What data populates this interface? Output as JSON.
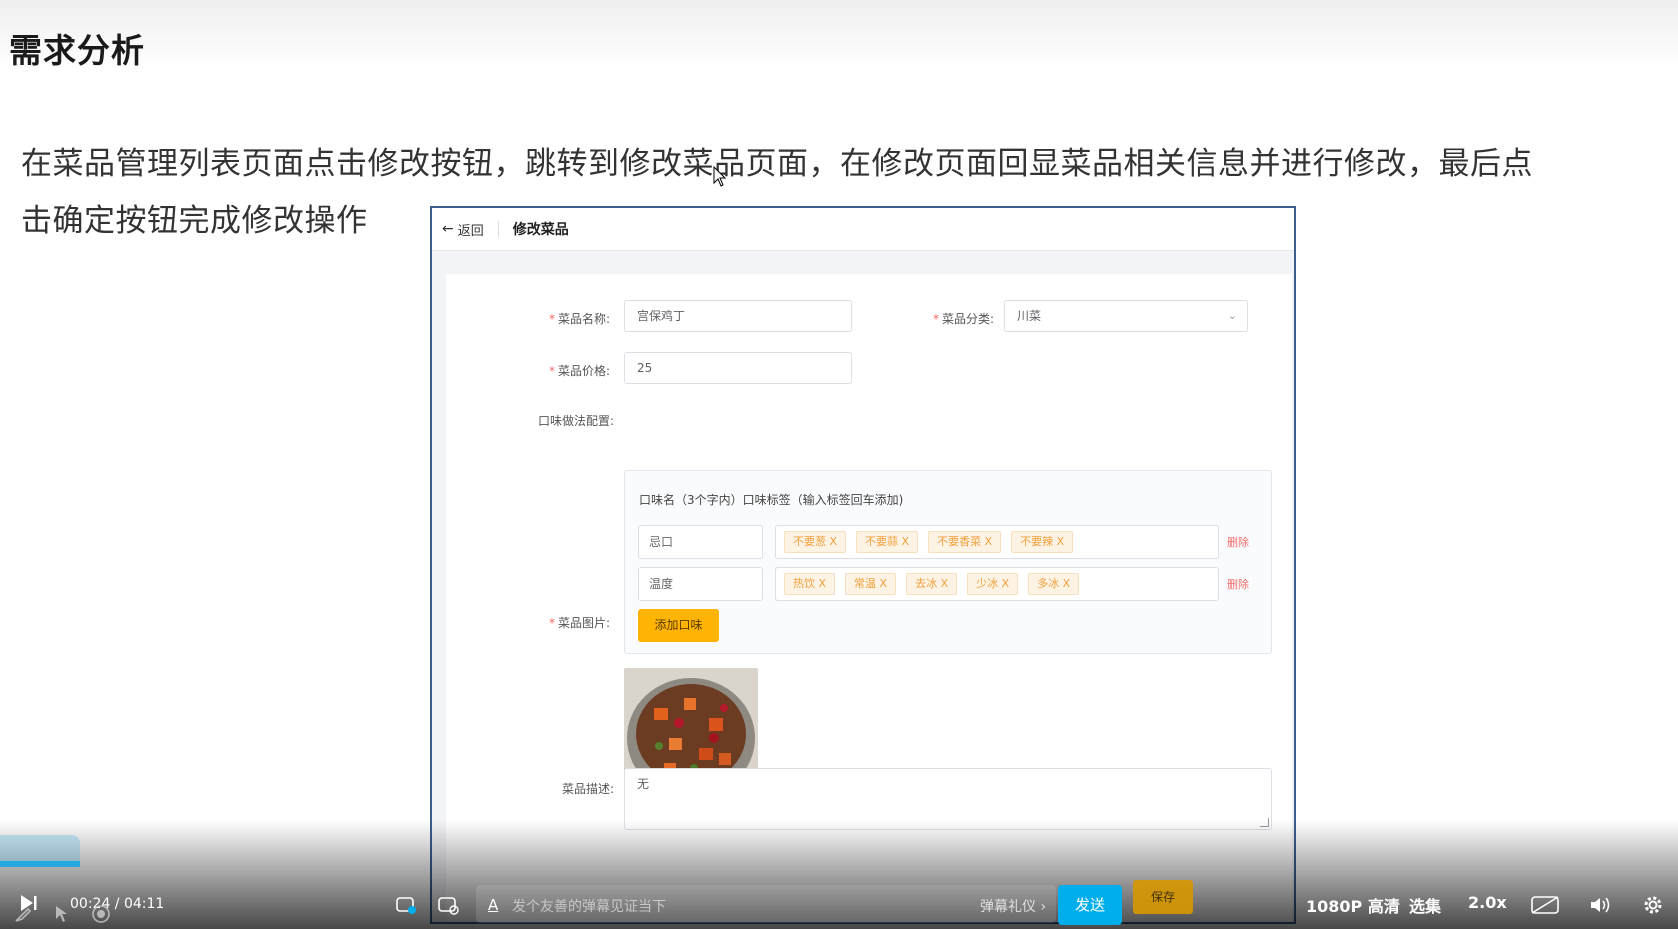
{
  "slide": {
    "title": "需求分析",
    "line1": "在菜品管理列表页面点击修改按钮，跳转到修改菜品页面，在修改页面回显菜品相关信息并进行修改，最后点",
    "line2": "击确定按钮完成修改操作"
  },
  "app": {
    "back_label": "返回",
    "page_title": "修改菜品",
    "form": {
      "name_label": "菜品名称:",
      "name_value": "宫保鸡丁",
      "category_label": "菜品分类:",
      "category_value": "川菜",
      "price_label": "菜品价格:",
      "price_value": "25",
      "flavor_label": "口味做法配置:",
      "flavor_hint": "口味名（3个字内）口味标签（输入标签回车添加)",
      "flavors": [
        {
          "name": "忌口",
          "tags": [
            "不要葱 X",
            "不要蒜 X",
            "不要香菜 X",
            "不要辣 X"
          ],
          "delete": "删除"
        },
        {
          "name": "温度",
          "tags": [
            "热饮 X",
            "常温 X",
            "去冰 X",
            "少冰 X",
            "多冰 X"
          ],
          "delete": "删除"
        }
      ],
      "add_flavor": "添加口味",
      "image_label": "菜品图片:",
      "desc_label": "菜品描述:",
      "desc_value": "无",
      "save_button": "保存"
    }
  },
  "player": {
    "current_time": "00:24",
    "separator": " / ",
    "total_time": "04:11",
    "danmaku_placeholder": "发个友善的弹幕见证当下",
    "danmaku_etiquette": "弹幕礼仪 ›",
    "send_label": "发送",
    "quality": "1080P 高清",
    "episodes": "选集",
    "speed": "2.0x",
    "progress_fraction": 0.096,
    "accent": "#00aeec"
  }
}
